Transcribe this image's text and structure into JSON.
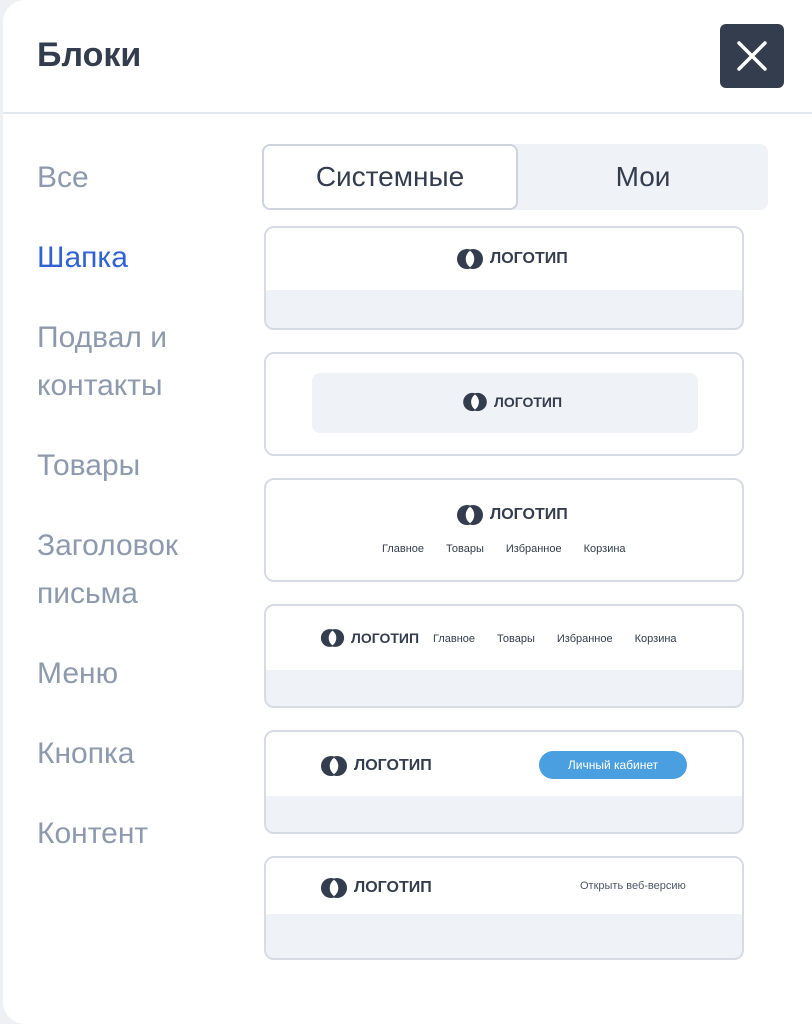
{
  "header": {
    "title": "Блоки"
  },
  "sidebar": {
    "items": [
      {
        "label": "Все"
      },
      {
        "label": "Шапка"
      },
      {
        "label_line1": "Подвал и",
        "label_line2": "контакты"
      },
      {
        "label": "Товары"
      },
      {
        "label_line1": "Заголовок",
        "label_line2": "письма"
      },
      {
        "label": "Меню"
      },
      {
        "label": "Кнопка"
      },
      {
        "label": "Контент"
      }
    ]
  },
  "tabs": {
    "system": "Системные",
    "mine": "Мои"
  },
  "blocks": {
    "logo_text": "ЛОГОТИП",
    "nav": [
      "Главное",
      "Товары",
      "Избранное",
      "Корзина"
    ],
    "account_button": "Личный кабинет",
    "web_version_link": "Открыть веб-версию"
  },
  "colors": {
    "accent": "#2f63d4",
    "dark": "#333d4d",
    "muted": "#8d9aad",
    "pill": "#4a9fe0"
  }
}
